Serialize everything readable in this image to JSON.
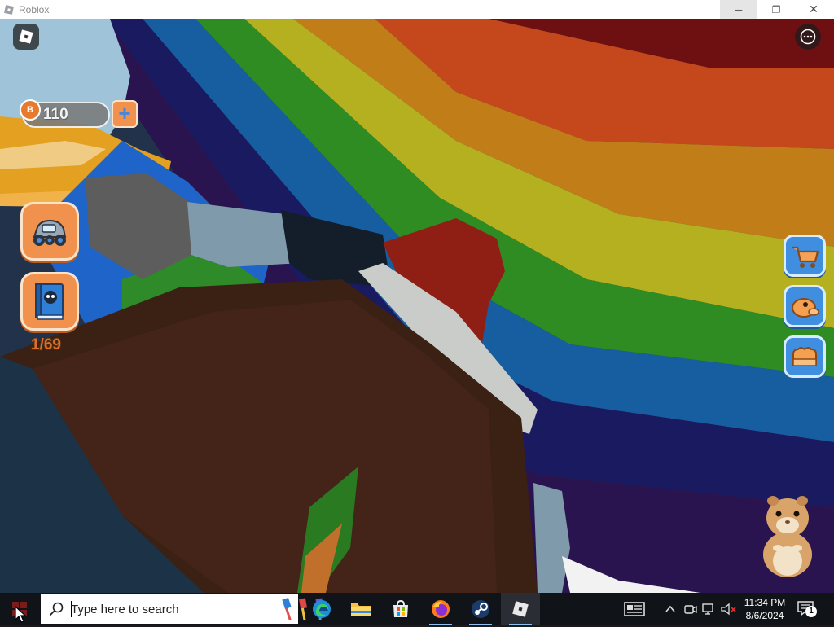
{
  "window": {
    "title": "Roblox",
    "minimize_glyph": "─",
    "maximize_glyph": "❐",
    "close_glyph": "✕"
  },
  "game": {
    "coins": {
      "amount": "110",
      "coin_symbol": "B",
      "add_symbol": "+"
    },
    "collection": {
      "count": "1/69"
    },
    "left_buttons": [
      {
        "name": "vehicle-button",
        "icon": "car-icon"
      },
      {
        "name": "book-button",
        "icon": "book-icon"
      }
    ],
    "right_buttons": [
      {
        "name": "shop-button",
        "icon": "shopping-cart-icon"
      },
      {
        "name": "pet-button",
        "icon": "pet-icon"
      },
      {
        "name": "inventory-button",
        "icon": "backpack-icon"
      }
    ],
    "colors": {
      "orange_button": "#f0924e",
      "blue_button": "#3f8ee0",
      "counter_text": "#d9702c"
    }
  },
  "taskbar": {
    "search": {
      "placeholder": "Type here to search"
    },
    "apps": [
      {
        "name": "edge-app",
        "icon": "edge-icon"
      },
      {
        "name": "file-explorer-app",
        "icon": "folder-icon"
      },
      {
        "name": "store-app",
        "icon": "store-icon"
      },
      {
        "name": "firefox-app",
        "icon": "firefox-icon"
      },
      {
        "name": "steam-app",
        "icon": "steam-icon"
      },
      {
        "name": "roblox-app",
        "icon": "roblox-icon"
      }
    ],
    "clock": {
      "time": "11:34 PM",
      "date": "8/6/2024"
    },
    "notifications": {
      "count": "1"
    }
  }
}
